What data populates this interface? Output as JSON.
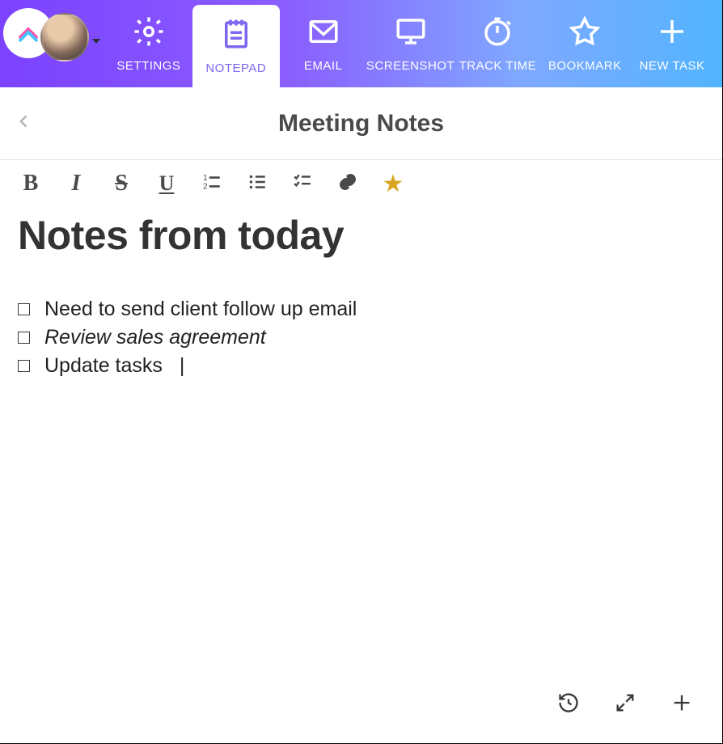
{
  "toolbar": {
    "items": [
      {
        "key": "settings",
        "label": "SETTINGS"
      },
      {
        "key": "notepad",
        "label": "NOTEPAD",
        "active": true
      },
      {
        "key": "email",
        "label": "EMAIL"
      },
      {
        "key": "screenshot",
        "label": "SCREENSHOT"
      },
      {
        "key": "tracktime",
        "label": "TRACK TIME"
      },
      {
        "key": "bookmark",
        "label": "BOOKMARK"
      },
      {
        "key": "newtask",
        "label": "NEW TASK"
      }
    ]
  },
  "page": {
    "title": "Meeting Notes"
  },
  "note": {
    "heading": "Notes from today",
    "items": [
      {
        "text": "Need to send client follow up email",
        "style": "normal"
      },
      {
        "text": "Review sales agreement",
        "style": "italic"
      },
      {
        "text": "Update tasks",
        "style": "normal",
        "cursor": true
      }
    ]
  },
  "format_buttons": [
    "bold",
    "italic",
    "strike",
    "underline",
    "numbered-list",
    "bullet-list",
    "check-list",
    "link",
    "star"
  ],
  "bottom_buttons": [
    "history",
    "expand",
    "add"
  ],
  "colors": {
    "gradient_start": "#7B42FF",
    "gradient_end": "#52B5FF",
    "accent": "#7B68EE",
    "star": "#D9A521"
  }
}
